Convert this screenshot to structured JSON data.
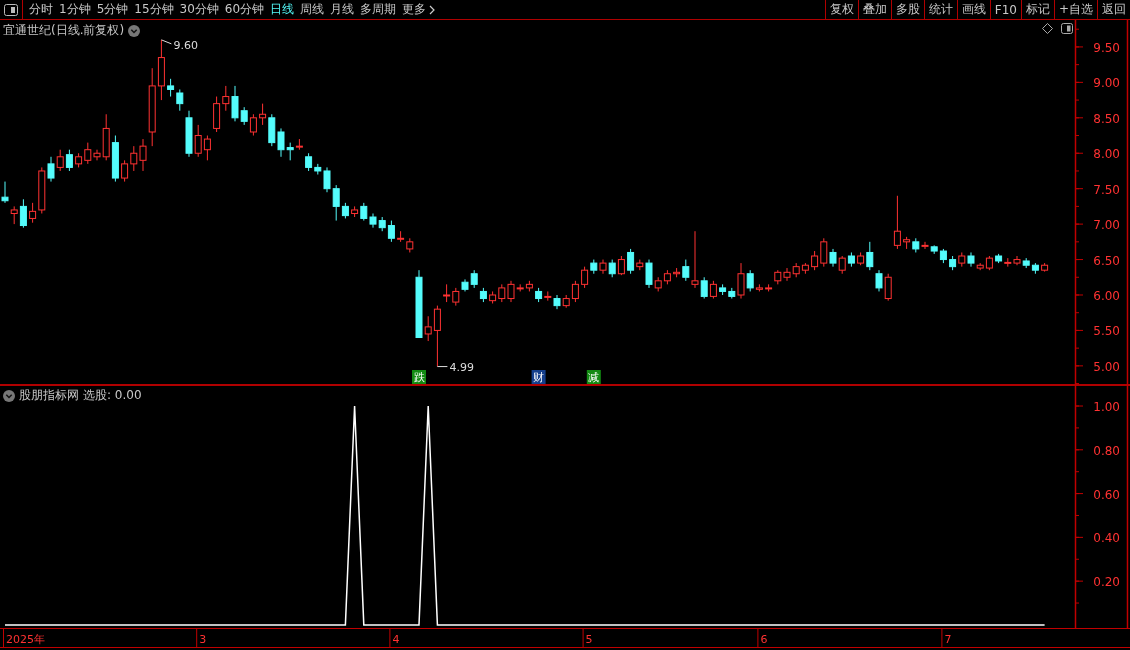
{
  "toolbar": {
    "periods": [
      {
        "label": "分时",
        "selected": false
      },
      {
        "label": "1分钟",
        "selected": false
      },
      {
        "label": "5分钟",
        "selected": false
      },
      {
        "label": "15分钟",
        "selected": false
      },
      {
        "label": "30分钟",
        "selected": false
      },
      {
        "label": "60分钟",
        "selected": false
      },
      {
        "label": "日线",
        "selected": true
      },
      {
        "label": "周线",
        "selected": false
      },
      {
        "label": "月线",
        "selected": false
      },
      {
        "label": "多周期",
        "selected": false
      }
    ],
    "more": "更多",
    "buttons": [
      "复权",
      "叠加",
      "多股",
      "统计",
      "画线",
      "F10",
      "标记",
      "+自选",
      "返回"
    ]
  },
  "price_panel": {
    "title": "宜通世纪(日线.前复权)",
    "chart_data": {
      "type": "candlestick",
      "ylim": [
        4.73,
        9.88
      ],
      "yticks": [
        {
          "value": 5,
          "label": "5.00"
        },
        {
          "value": 5.5,
          "label": "5.50"
        },
        {
          "value": 6,
          "label": "6.00"
        },
        {
          "value": 6.5,
          "label": "6.50"
        },
        {
          "value": 7,
          "label": "7.00"
        },
        {
          "value": 7.5,
          "label": "7.50"
        },
        {
          "value": 8,
          "label": "8.00"
        },
        {
          "value": 8.5,
          "label": "8.50"
        },
        {
          "value": 9,
          "label": "9.00"
        },
        {
          "value": 9.5,
          "label": "9.50"
        }
      ],
      "ohlc": [
        [
          7.38,
          7.6,
          7.3,
          7.33
        ],
        [
          7.15,
          7.25,
          7.0,
          7.2
        ],
        [
          7.25,
          7.35,
          6.95,
          6.98
        ],
        [
          7.08,
          7.3,
          7.02,
          7.18
        ],
        [
          7.2,
          7.8,
          7.15,
          7.75
        ],
        [
          7.85,
          7.95,
          7.6,
          7.65
        ],
        [
          7.8,
          8.05,
          7.75,
          7.95
        ],
        [
          7.98,
          8.05,
          7.75,
          7.8
        ],
        [
          7.85,
          8.0,
          7.8,
          7.95
        ],
        [
          7.9,
          8.15,
          7.85,
          8.05
        ],
        [
          7.95,
          8.05,
          7.9,
          8.0
        ],
        [
          7.95,
          8.55,
          7.9,
          8.35
        ],
        [
          8.15,
          8.25,
          7.6,
          7.65
        ],
        [
          7.65,
          7.9,
          7.6,
          7.85
        ],
        [
          7.85,
          8.1,
          7.75,
          8.0
        ],
        [
          7.9,
          8.2,
          7.75,
          8.1
        ],
        [
          8.3,
          9.2,
          8.1,
          8.95
        ],
        [
          8.95,
          9.6,
          8.75,
          9.35
        ],
        [
          8.95,
          9.05,
          8.8,
          8.9
        ],
        [
          8.85,
          8.9,
          8.6,
          8.7
        ],
        [
          8.5,
          8.6,
          7.95,
          8.0
        ],
        [
          8.0,
          8.4,
          7.95,
          8.25
        ],
        [
          8.05,
          8.25,
          7.9,
          8.2
        ],
        [
          8.35,
          8.8,
          8.3,
          8.7
        ],
        [
          8.7,
          8.95,
          8.6,
          8.8
        ],
        [
          8.8,
          8.95,
          8.45,
          8.5
        ],
        [
          8.6,
          8.65,
          8.4,
          8.45
        ],
        [
          8.3,
          8.55,
          8.25,
          8.5
        ],
        [
          8.5,
          8.7,
          8.4,
          8.55
        ],
        [
          8.5,
          8.55,
          8.1,
          8.15
        ],
        [
          8.3,
          8.35,
          7.95,
          8.05
        ],
        [
          8.08,
          8.15,
          7.9,
          8.05
        ],
        [
          8.1,
          8.2,
          8.05,
          8.1
        ],
        [
          7.95,
          8.0,
          7.75,
          7.8
        ],
        [
          7.8,
          7.85,
          7.7,
          7.75
        ],
        [
          7.75,
          7.8,
          7.45,
          7.5
        ],
        [
          7.5,
          7.55,
          7.05,
          7.25
        ],
        [
          7.25,
          7.3,
          7.08,
          7.12
        ],
        [
          7.15,
          7.25,
          7.1,
          7.2
        ],
        [
          7.25,
          7.3,
          7.05,
          7.08
        ],
        [
          7.1,
          7.15,
          6.95,
          7.0
        ],
        [
          7.05,
          7.1,
          6.9,
          6.95
        ],
        [
          6.98,
          7.05,
          6.75,
          6.8
        ],
        [
          6.8,
          6.9,
          6.75,
          6.8
        ],
        [
          6.65,
          6.8,
          6.6,
          6.75
        ],
        [
          6.25,
          6.35,
          5.4,
          5.4
        ],
        [
          5.45,
          5.7,
          5.35,
          5.55
        ],
        [
          5.5,
          5.85,
          4.99,
          5.8
        ],
        [
          6.0,
          6.15,
          5.9,
          6.0
        ],
        [
          5.9,
          6.1,
          5.85,
          6.05
        ],
        [
          6.18,
          6.22,
          6.05,
          6.08
        ],
        [
          6.3,
          6.35,
          6.1,
          6.15
        ],
        [
          6.05,
          6.1,
          5.9,
          5.95
        ],
        [
          5.92,
          6.05,
          5.88,
          6.0
        ],
        [
          5.95,
          6.15,
          5.9,
          6.1
        ],
        [
          5.95,
          6.2,
          5.9,
          6.15
        ],
        [
          6.1,
          6.15,
          6.05,
          6.1
        ],
        [
          6.1,
          6.2,
          6.05,
          6.15
        ],
        [
          6.05,
          6.1,
          5.9,
          5.95
        ],
        [
          5.98,
          6.05,
          5.92,
          5.98
        ],
        [
          5.95,
          6.0,
          5.8,
          5.85
        ],
        [
          5.85,
          6.0,
          5.82,
          5.95
        ],
        [
          5.95,
          6.2,
          5.9,
          6.15
        ],
        [
          6.15,
          6.4,
          6.1,
          6.35
        ],
        [
          6.45,
          6.5,
          6.3,
          6.35
        ],
        [
          6.35,
          6.5,
          6.3,
          6.45
        ],
        [
          6.45,
          6.5,
          6.25,
          6.3
        ],
        [
          6.3,
          6.55,
          6.28,
          6.5
        ],
        [
          6.6,
          6.65,
          6.3,
          6.35
        ],
        [
          6.4,
          6.5,
          6.35,
          6.45
        ],
        [
          6.45,
          6.5,
          6.1,
          6.15
        ],
        [
          6.1,
          6.25,
          6.05,
          6.2
        ],
        [
          6.2,
          6.35,
          6.15,
          6.3
        ],
        [
          6.3,
          6.38,
          6.25,
          6.32
        ],
        [
          6.4,
          6.5,
          6.2,
          6.25
        ],
        [
          6.15,
          6.9,
          6.1,
          6.2
        ],
        [
          6.2,
          6.25,
          5.95,
          5.98
        ],
        [
          5.98,
          6.2,
          5.95,
          6.15
        ],
        [
          6.1,
          6.15,
          6.0,
          6.05
        ],
        [
          6.05,
          6.1,
          5.95,
          5.98
        ],
        [
          6.0,
          6.45,
          5.95,
          6.3
        ],
        [
          6.3,
          6.35,
          6.05,
          6.1
        ],
        [
          6.08,
          6.15,
          6.05,
          6.1
        ],
        [
          6.1,
          6.15,
          6.05,
          6.1
        ],
        [
          6.2,
          6.35,
          6.15,
          6.32
        ],
        [
          6.25,
          6.38,
          6.2,
          6.32
        ],
        [
          6.3,
          6.45,
          6.25,
          6.4
        ],
        [
          6.35,
          6.45,
          6.3,
          6.42
        ],
        [
          6.4,
          6.62,
          6.35,
          6.55
        ],
        [
          6.45,
          6.8,
          6.4,
          6.75
        ],
        [
          6.6,
          6.65,
          6.4,
          6.45
        ],
        [
          6.35,
          6.55,
          6.3,
          6.52
        ],
        [
          6.55,
          6.6,
          6.4,
          6.45
        ],
        [
          6.45,
          6.6,
          6.42,
          6.55
        ],
        [
          6.6,
          6.75,
          6.35,
          6.4
        ],
        [
          6.3,
          6.35,
          6.05,
          6.1
        ],
        [
          5.95,
          6.3,
          5.92,
          6.25
        ],
        [
          6.7,
          7.4,
          6.65,
          6.9
        ],
        [
          6.75,
          6.82,
          6.65,
          6.78
        ],
        [
          6.75,
          6.8,
          6.6,
          6.65
        ],
        [
          6.7,
          6.75,
          6.65,
          6.7
        ],
        [
          6.68,
          6.7,
          6.58,
          6.62
        ],
        [
          6.62,
          6.65,
          6.45,
          6.5
        ],
        [
          6.5,
          6.55,
          6.35,
          6.4
        ],
        [
          6.45,
          6.6,
          6.4,
          6.55
        ],
        [
          6.55,
          6.6,
          6.4,
          6.45
        ],
        [
          6.38,
          6.45,
          6.35,
          6.42
        ],
        [
          6.38,
          6.55,
          6.35,
          6.52
        ],
        [
          6.55,
          6.58,
          6.45,
          6.48
        ],
        [
          6.45,
          6.52,
          6.4,
          6.46
        ],
        [
          6.45,
          6.55,
          6.42,
          6.5
        ],
        [
          6.48,
          6.52,
          6.38,
          6.42
        ],
        [
          6.42,
          6.45,
          6.3,
          6.35
        ],
        [
          6.35,
          6.45,
          6.33,
          6.42
        ]
      ],
      "annotations": [
        "9.60",
        "4.99"
      ]
    },
    "event_markers": [
      {
        "label": "跌",
        "color": "#128a12"
      },
      {
        "label": "财",
        "color": "#153f8c"
      },
      {
        "label": "减",
        "color": "#128a12"
      }
    ]
  },
  "indicator_panel": {
    "name": "股朋指标网",
    "reading": "选股: 0.00",
    "chart_data": {
      "type": "line",
      "ylim": [
        -0.014,
        1.096
      ],
      "yticks": [
        {
          "value": 0.2,
          "label": "0.20"
        },
        {
          "value": 0.4,
          "label": "0.40"
        },
        {
          "value": 0.6,
          "label": "0.60"
        },
        {
          "value": 0.8,
          "label": "0.80"
        },
        {
          "value": 1,
          "label": "1.00"
        }
      ],
      "series": [
        {
          "color": "#ffffff",
          "values": [
            0,
            0,
            0,
            0,
            0,
            0,
            0,
            0,
            0,
            0,
            0,
            0,
            0,
            0,
            0,
            0,
            0,
            0,
            0,
            0,
            0,
            0,
            0,
            0,
            0,
            0,
            0,
            0,
            0,
            0,
            0,
            0,
            0,
            0,
            0,
            0,
            0,
            0,
            1,
            0,
            0,
            0,
            0,
            0,
            0,
            0,
            1,
            0,
            0,
            0,
            0,
            0,
            0,
            0,
            0,
            0,
            0,
            0,
            0,
            0,
            0,
            0,
            0,
            0,
            0,
            0,
            0,
            0,
            0,
            0,
            0,
            0,
            0,
            0,
            0,
            0,
            0,
            0,
            0,
            0,
            0,
            0,
            0,
            0,
            0,
            0,
            0,
            0,
            0,
            0,
            0,
            0,
            0,
            0,
            0,
            0,
            0,
            0,
            0,
            0,
            0,
            0,
            0,
            0,
            0,
            0,
            0,
            0,
            0,
            0,
            0,
            0,
            0,
            0
          ]
        }
      ]
    }
  },
  "date_axis": [
    "2025年",
    "3",
    "4",
    "5",
    "6",
    "7"
  ]
}
